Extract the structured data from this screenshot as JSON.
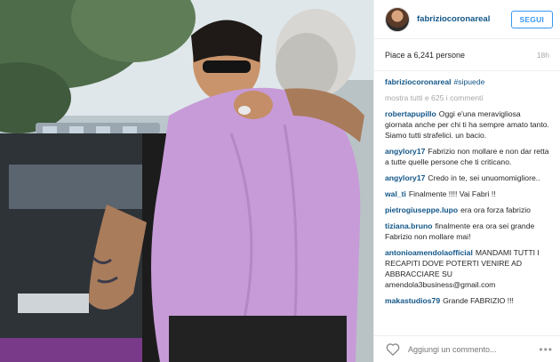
{
  "post": {
    "username": "fabriziocoronareal",
    "follow_label": "SEGUI",
    "likes": "Piace a 6,241 persone",
    "age": "18h",
    "caption": {
      "user": "fabriziocoronareal",
      "text": "#sipuede"
    },
    "view_all": "mostra tutti e 625 i commenti",
    "comments": [
      {
        "user": "robertapupillo",
        "text": "Oggi e'una meravigliosa giornata anche per chi ti ha sempre amato tanto. Siamo tutti strafelici. un bacio."
      },
      {
        "user": "angylory17",
        "text": "Fabrizio non mollare e non dar retta a tutte quelle persone che ti criticano."
      },
      {
        "user": "angylory17",
        "text": "Credo in te, sei unuomomigliore.."
      },
      {
        "user": "wal_ti",
        "text": "Finalmente !!!! Vai Fabri !!"
      },
      {
        "user": "pietrogiuseppe.lupo",
        "text": "era ora forza fabrizio"
      },
      {
        "user": "tiziana.bruno",
        "text": "finalmente era ora sei grande Fabrizio non mollare mai!"
      },
      {
        "user": "antonioamendolaofficial",
        "text": "MANDAMI TUTTI I RECAPITI DOVE POTERTI VENIRE AD ABBRACCIARE SU amendola3business@gmail.com"
      },
      {
        "user": "makastudios79",
        "text": "Grande FABRIZIO !!!"
      }
    ],
    "comment_placeholder": "Aggiungi un commento...",
    "more_label": "•••",
    "icons": {
      "heart": "heart-outline-icon",
      "more": "more-dots-icon"
    },
    "colors": {
      "username": "#125688",
      "follow": "#3897f0",
      "muted": "#a5a7aa"
    }
  }
}
